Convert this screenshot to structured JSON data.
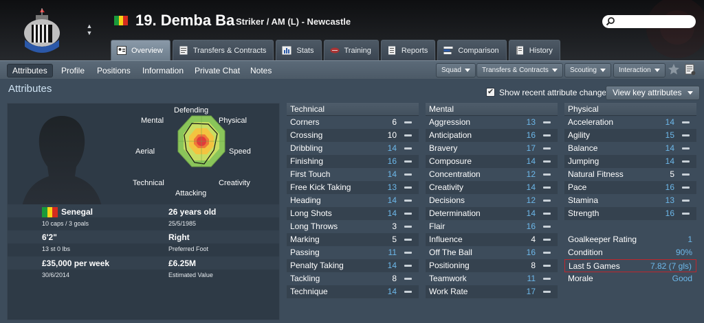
{
  "header": {
    "number_name": "19. Demba Ba",
    "role": "Striker / AM (L) - Newcastle",
    "search_placeholder": ""
  },
  "tabs": [
    {
      "label": "Overview",
      "icon": "person-card-icon",
      "active": true
    },
    {
      "label": "Transfers & Contracts",
      "icon": "document-icon"
    },
    {
      "label": "Stats",
      "icon": "stats-icon"
    },
    {
      "label": "Training",
      "icon": "ball-icon"
    },
    {
      "label": "Reports",
      "icon": "report-icon"
    },
    {
      "label": "Comparison",
      "icon": "comparison-icon"
    },
    {
      "label": "History",
      "icon": "book-icon"
    }
  ],
  "subnav": {
    "items": [
      "Attributes",
      "Profile",
      "Positions",
      "Information",
      "Private Chat",
      "Notes"
    ],
    "buttons": [
      "Squad",
      "Transfers & Contracts",
      "Scouting",
      "Interaction"
    ]
  },
  "main": {
    "title": "Attributes",
    "checkbox_label": "Show recent attribute changes",
    "key_button": "View key attributes"
  },
  "radar": {
    "labels": {
      "defending": "Defending",
      "physical": "Physical",
      "speed": "Speed",
      "creativity": "Creativity",
      "attacking": "Attacking",
      "technical": "Technical",
      "aerial": "Aerial",
      "mental": "Mental"
    }
  },
  "profile": {
    "nationality": "Senegal",
    "caps": "10 caps / 3 goals",
    "age": "26 years old",
    "dob": "25/5/1985",
    "height": "6'2\"",
    "weight": "13 st 0 lbs",
    "foot": "Right",
    "foot_label": "Preferred Foot",
    "wage": "£35,000 per week",
    "contract_end": "30/6/2014",
    "value": "£6.25M",
    "value_label": "Estimated Value"
  },
  "technical": {
    "title": "Technical",
    "attrs": [
      {
        "name": "Corners",
        "value": "6",
        "hi": false
      },
      {
        "name": "Crossing",
        "value": "10",
        "hi": false
      },
      {
        "name": "Dribbling",
        "value": "14",
        "hi": true
      },
      {
        "name": "Finishing",
        "value": "16",
        "hi": true
      },
      {
        "name": "First Touch",
        "value": "14",
        "hi": true
      },
      {
        "name": "Free Kick Taking",
        "value": "13",
        "hi": true
      },
      {
        "name": "Heading",
        "value": "14",
        "hi": true
      },
      {
        "name": "Long Shots",
        "value": "14",
        "hi": true
      },
      {
        "name": "Long Throws",
        "value": "3",
        "hi": false
      },
      {
        "name": "Marking",
        "value": "5",
        "hi": false
      },
      {
        "name": "Passing",
        "value": "11",
        "hi": true
      },
      {
        "name": "Penalty Taking",
        "value": "14",
        "hi": true
      },
      {
        "name": "Tackling",
        "value": "8",
        "hi": false
      },
      {
        "name": "Technique",
        "value": "14",
        "hi": true
      }
    ]
  },
  "mental": {
    "title": "Mental",
    "attrs": [
      {
        "name": "Aggression",
        "value": "13",
        "hi": true
      },
      {
        "name": "Anticipation",
        "value": "16",
        "hi": true
      },
      {
        "name": "Bravery",
        "value": "17",
        "hi": true
      },
      {
        "name": "Composure",
        "value": "14",
        "hi": true
      },
      {
        "name": "Concentration",
        "value": "12",
        "hi": true
      },
      {
        "name": "Creativity",
        "value": "14",
        "hi": true
      },
      {
        "name": "Decisions",
        "value": "12",
        "hi": true
      },
      {
        "name": "Determination",
        "value": "14",
        "hi": true
      },
      {
        "name": "Flair",
        "value": "16",
        "hi": true
      },
      {
        "name": "Influence",
        "value": "4",
        "hi": false
      },
      {
        "name": "Off The Ball",
        "value": "16",
        "hi": true
      },
      {
        "name": "Positioning",
        "value": "8",
        "hi": false
      },
      {
        "name": "Teamwork",
        "value": "11",
        "hi": true
      },
      {
        "name": "Work Rate",
        "value": "17",
        "hi": true
      }
    ]
  },
  "physical": {
    "title": "Physical",
    "attrs": [
      {
        "name": "Acceleration",
        "value": "14",
        "hi": true
      },
      {
        "name": "Agility",
        "value": "15",
        "hi": true
      },
      {
        "name": "Balance",
        "value": "14",
        "hi": true
      },
      {
        "name": "Jumping",
        "value": "14",
        "hi": true
      },
      {
        "name": "Natural Fitness",
        "value": "5",
        "hi": false
      },
      {
        "name": "Pace",
        "value": "16",
        "hi": true
      },
      {
        "name": "Stamina",
        "value": "13",
        "hi": true
      },
      {
        "name": "Strength",
        "value": "16",
        "hi": true
      }
    ],
    "stats": [
      {
        "name": "Goalkeeper Rating",
        "value": "1"
      },
      {
        "name": "Condition",
        "value": "90%"
      },
      {
        "name": "Last 5 Games",
        "value": "7.82 (7 gls)"
      },
      {
        "name": "Morale",
        "value": "Good"
      }
    ]
  },
  "colors": {
    "highlight_value": "#6db8ea",
    "highlight_border": "#c0262c"
  }
}
